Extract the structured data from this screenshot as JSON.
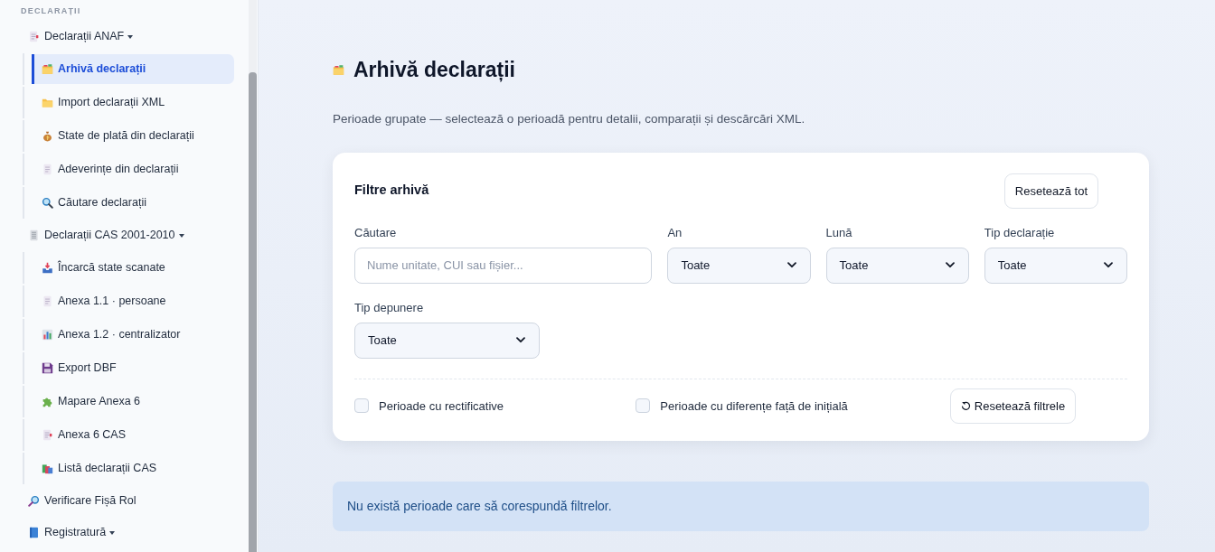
{
  "sidebar": {
    "section_title": "DECLARAȚII",
    "items": [
      {
        "kind": "group",
        "label": "Declarații ANAF",
        "selected": false,
        "children": [
          {
            "label": "Arhivă declarații",
            "selected": true
          },
          {
            "label": "Import declarații XML",
            "selected": false
          },
          {
            "label": "State de plată din declarații",
            "selected": false
          },
          {
            "label": "Adeverințe din declarații",
            "selected": false
          },
          {
            "label": "Căutare declarații",
            "selected": false
          }
        ]
      },
      {
        "kind": "group",
        "label": "Declarații CAS 2001-2010",
        "selected": false,
        "children": [
          {
            "label": "Încarcă state scanate",
            "selected": false
          },
          {
            "label": "Anexa 1.1 · persoane",
            "selected": false
          },
          {
            "label": "Anexa 1.2 · centralizator",
            "selected": false
          },
          {
            "label": "Export DBF",
            "selected": false
          },
          {
            "label": "Mapare Anexa 6",
            "selected": false
          },
          {
            "label": "Anexa 6 CAS",
            "selected": false
          },
          {
            "label": "Listă declarații CAS",
            "selected": false
          }
        ]
      },
      {
        "kind": "link",
        "label": "Verificare Fișă Rol",
        "selected": false
      },
      {
        "kind": "group",
        "label": "Registratură",
        "selected": false
      }
    ]
  },
  "page": {
    "title": "Arhivă declarații",
    "subtitle": "Perioade grupate — selectează o perioadă pentru detalii, comparații și descărcări XML."
  },
  "filters": {
    "title": "Filtre arhivă",
    "reset_all_button": "Resetează tot",
    "fields": [
      {
        "kind": "text",
        "label": "Căutare",
        "placeholder": "Nume unitate, CUI sau fișier..."
      },
      {
        "kind": "select",
        "label": "An",
        "value": "Toate"
      },
      {
        "kind": "select",
        "label": "Lună",
        "value": "Toate"
      },
      {
        "kind": "select",
        "label": "Tip declarație",
        "value": "Toate"
      },
      {
        "kind": "select",
        "label": "Tip depunere",
        "value": "Toate"
      }
    ],
    "checkboxes": [
      {
        "label": "Perioade cu rectificative",
        "checked": false
      },
      {
        "label": "Perioade cu diferențe față de inițială",
        "checked": false
      }
    ],
    "reset_filters_button": "Resetează filtrele"
  },
  "alert": {
    "text": "Nu există perioade care să corespundă filtrelor."
  }
}
